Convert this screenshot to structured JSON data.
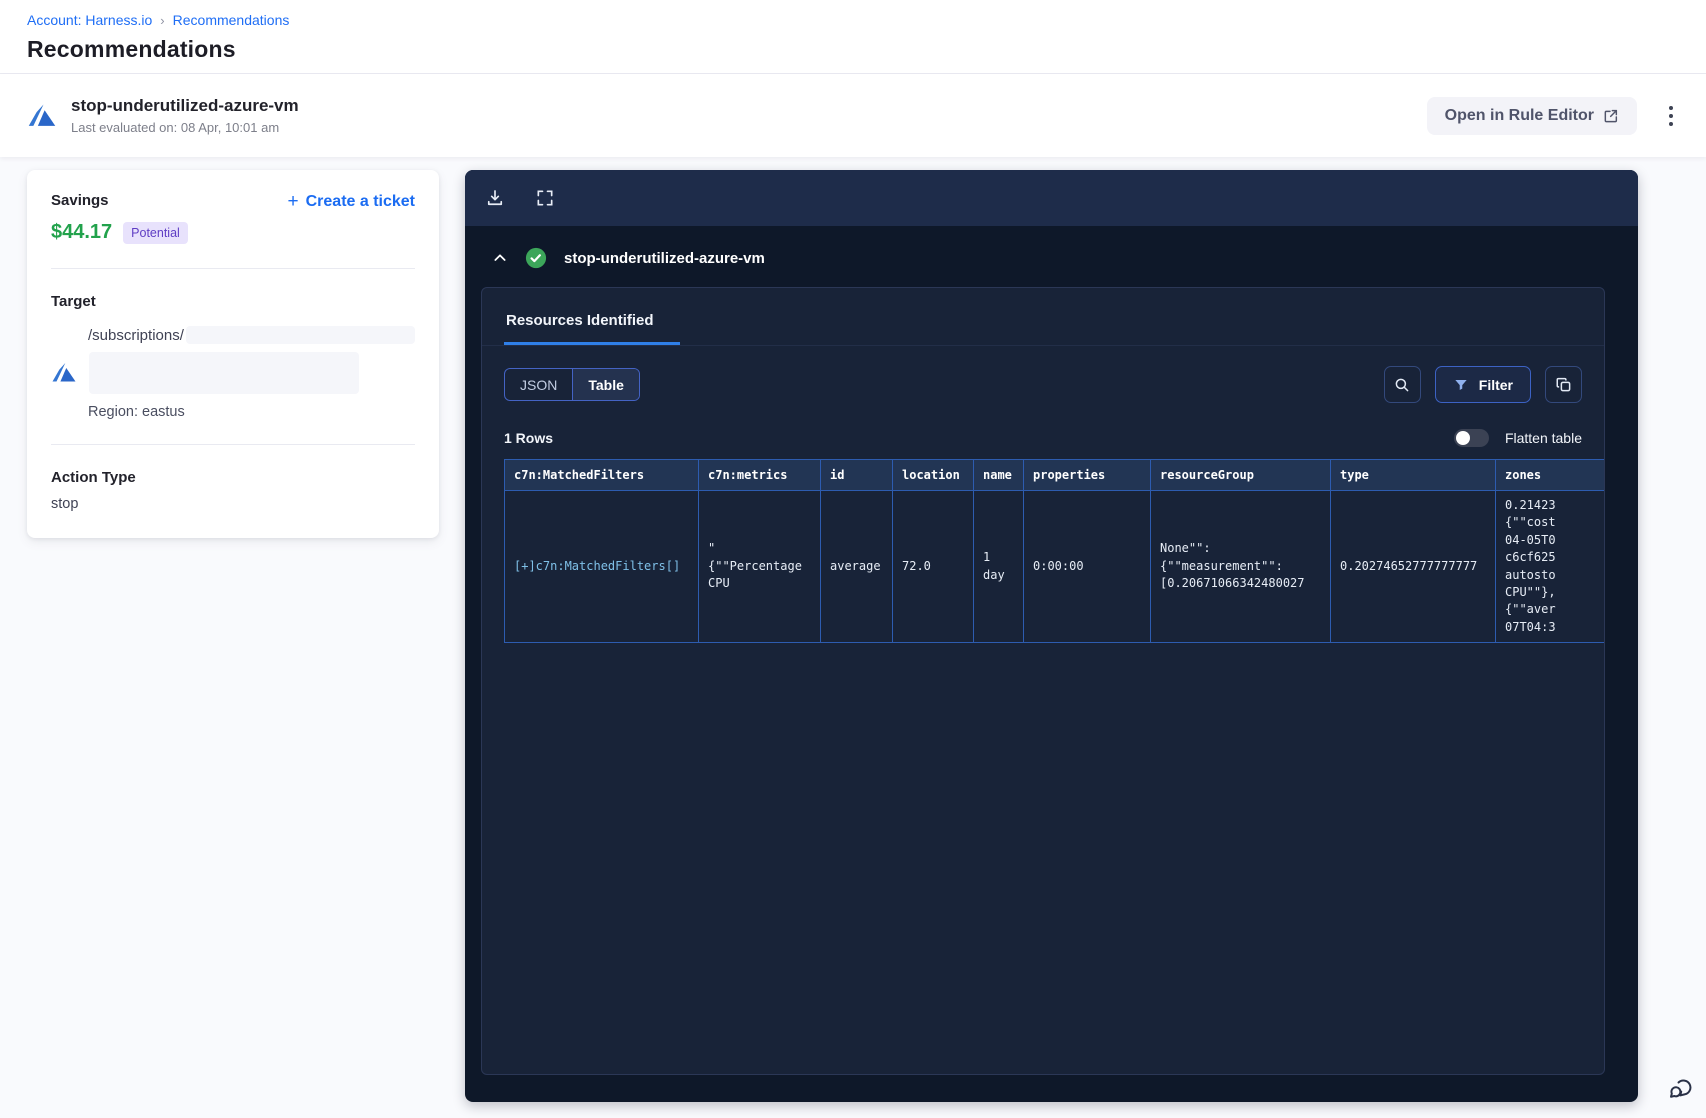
{
  "breadcrumb": {
    "separator": "›",
    "items": [
      {
        "label": "Account: Harness.io"
      },
      {
        "label": "Recommendations"
      }
    ]
  },
  "page": {
    "title": "Recommendations"
  },
  "recommendation_header": {
    "title": "stop-underutilized-azure-vm",
    "last_evaluated": "Last evaluated on: 08 Apr, 10:01 am",
    "open_rule_editor_label": "Open in Rule Editor"
  },
  "savings_card": {
    "savings_label": "Savings",
    "amount": "$44.17",
    "badge": "Potential",
    "create_ticket_label": "Create a ticket",
    "create_ticket_plus": "+",
    "target_label": "Target",
    "target_path": "/subscriptions/",
    "region": "Region: eastus",
    "action_type_label": "Action Type",
    "action_type_value": "stop"
  },
  "panel": {
    "resource_title": "stop-underutilized-azure-vm",
    "tab_label": "Resources Identified",
    "view_toggle": {
      "json": "JSON",
      "table": "Table"
    },
    "filter_label": "Filter",
    "rows_count": "1 Rows",
    "flatten_label": "Flatten table"
  },
  "table": {
    "columns": [
      "c7n:MatchedFilters",
      "c7n:metrics",
      "id",
      "location",
      "name",
      "properties",
      "resourceGroup",
      "type",
      "zones"
    ],
    "rows": [
      [
        "[+]c7n:MatchedFilters[]",
        "\"\n{\"\"Percentage\nCPU",
        "average",
        "72.0",
        "1 day",
        "0:00:00",
        "None\"\":\n{\"\"measurement\"\":\n[0.20671066342480027",
        "0.20274652777777777",
        "0.21423\n{\"\"cost\n04-05T0\nc6cf625\nautosto\nCPU\"\"},\n{\"\"aver\n07T04:3"
      ]
    ]
  },
  "icons": {
    "azure-icon": "azure triangle logo",
    "download-icon": "arrow into tray",
    "fullscreen-icon": "corner brackets",
    "chevron-up-icon": "collapse caret",
    "check-circle-icon": "green success check",
    "search-icon": "magnifier",
    "filter-icon": "funnel",
    "copy-icon": "overlapping squares",
    "external-link-icon": "box with arrow",
    "kebab-icon": "three vertical dots",
    "chat-icon": "speech bubbles"
  },
  "colors": {
    "link_blue": "#1f6ef5",
    "savings_green": "#22a24c",
    "badge_bg": "#e8e2fc",
    "badge_text": "#5f3dc4",
    "panel_bg": "#0e1829",
    "toolbar_bg": "#1e2c4a",
    "inner_card_bg": "#182338",
    "table_border": "#2d5cb0",
    "tab_underline": "#2f7fe8",
    "check_green": "#3ca65a"
  }
}
